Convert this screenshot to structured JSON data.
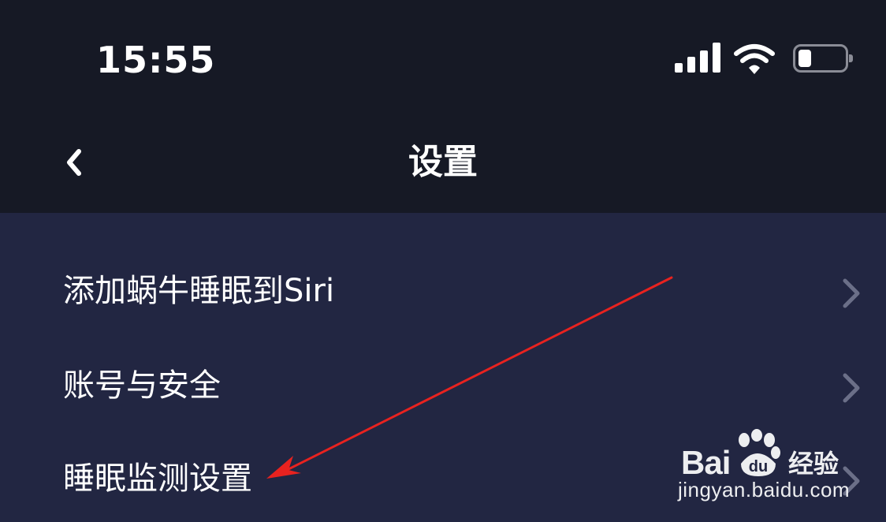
{
  "status_bar": {
    "time": "15:55",
    "icons": [
      "signal-icon",
      "wifi-icon",
      "battery-icon"
    ],
    "battery_level": 0.25
  },
  "nav": {
    "back_icon": "chevron-left-icon",
    "title": "设置"
  },
  "settings": {
    "items": [
      {
        "label": "添加蜗牛睡眠到Siri",
        "icon": "chevron-right-icon"
      },
      {
        "label": "账号与安全",
        "icon": "chevron-right-icon"
      },
      {
        "label": "睡眠监测设置",
        "icon": "chevron-right-icon"
      }
    ]
  },
  "annotation": {
    "type": "red-arrow",
    "color": "#e8221f",
    "points_to": "睡眠监测设置"
  },
  "watermark": {
    "brand": "Bai",
    "du": "du",
    "cn": "经验",
    "url": "jingyan.baidu.com"
  },
  "colors": {
    "header_bg": "#161925",
    "list_bg": "#222642",
    "chevron": "#6b6f88",
    "text": "#ffffff"
  }
}
